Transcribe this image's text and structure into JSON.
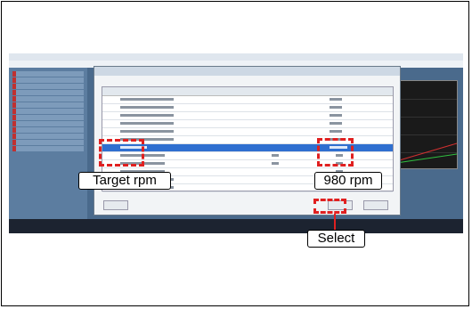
{
  "annotations": {
    "target_rpm": "Target rpm",
    "rpm_value": "980 rpm",
    "select": "Select"
  },
  "colors": {
    "highlight": "#e02020",
    "selected_row": "#2f6fd0"
  }
}
